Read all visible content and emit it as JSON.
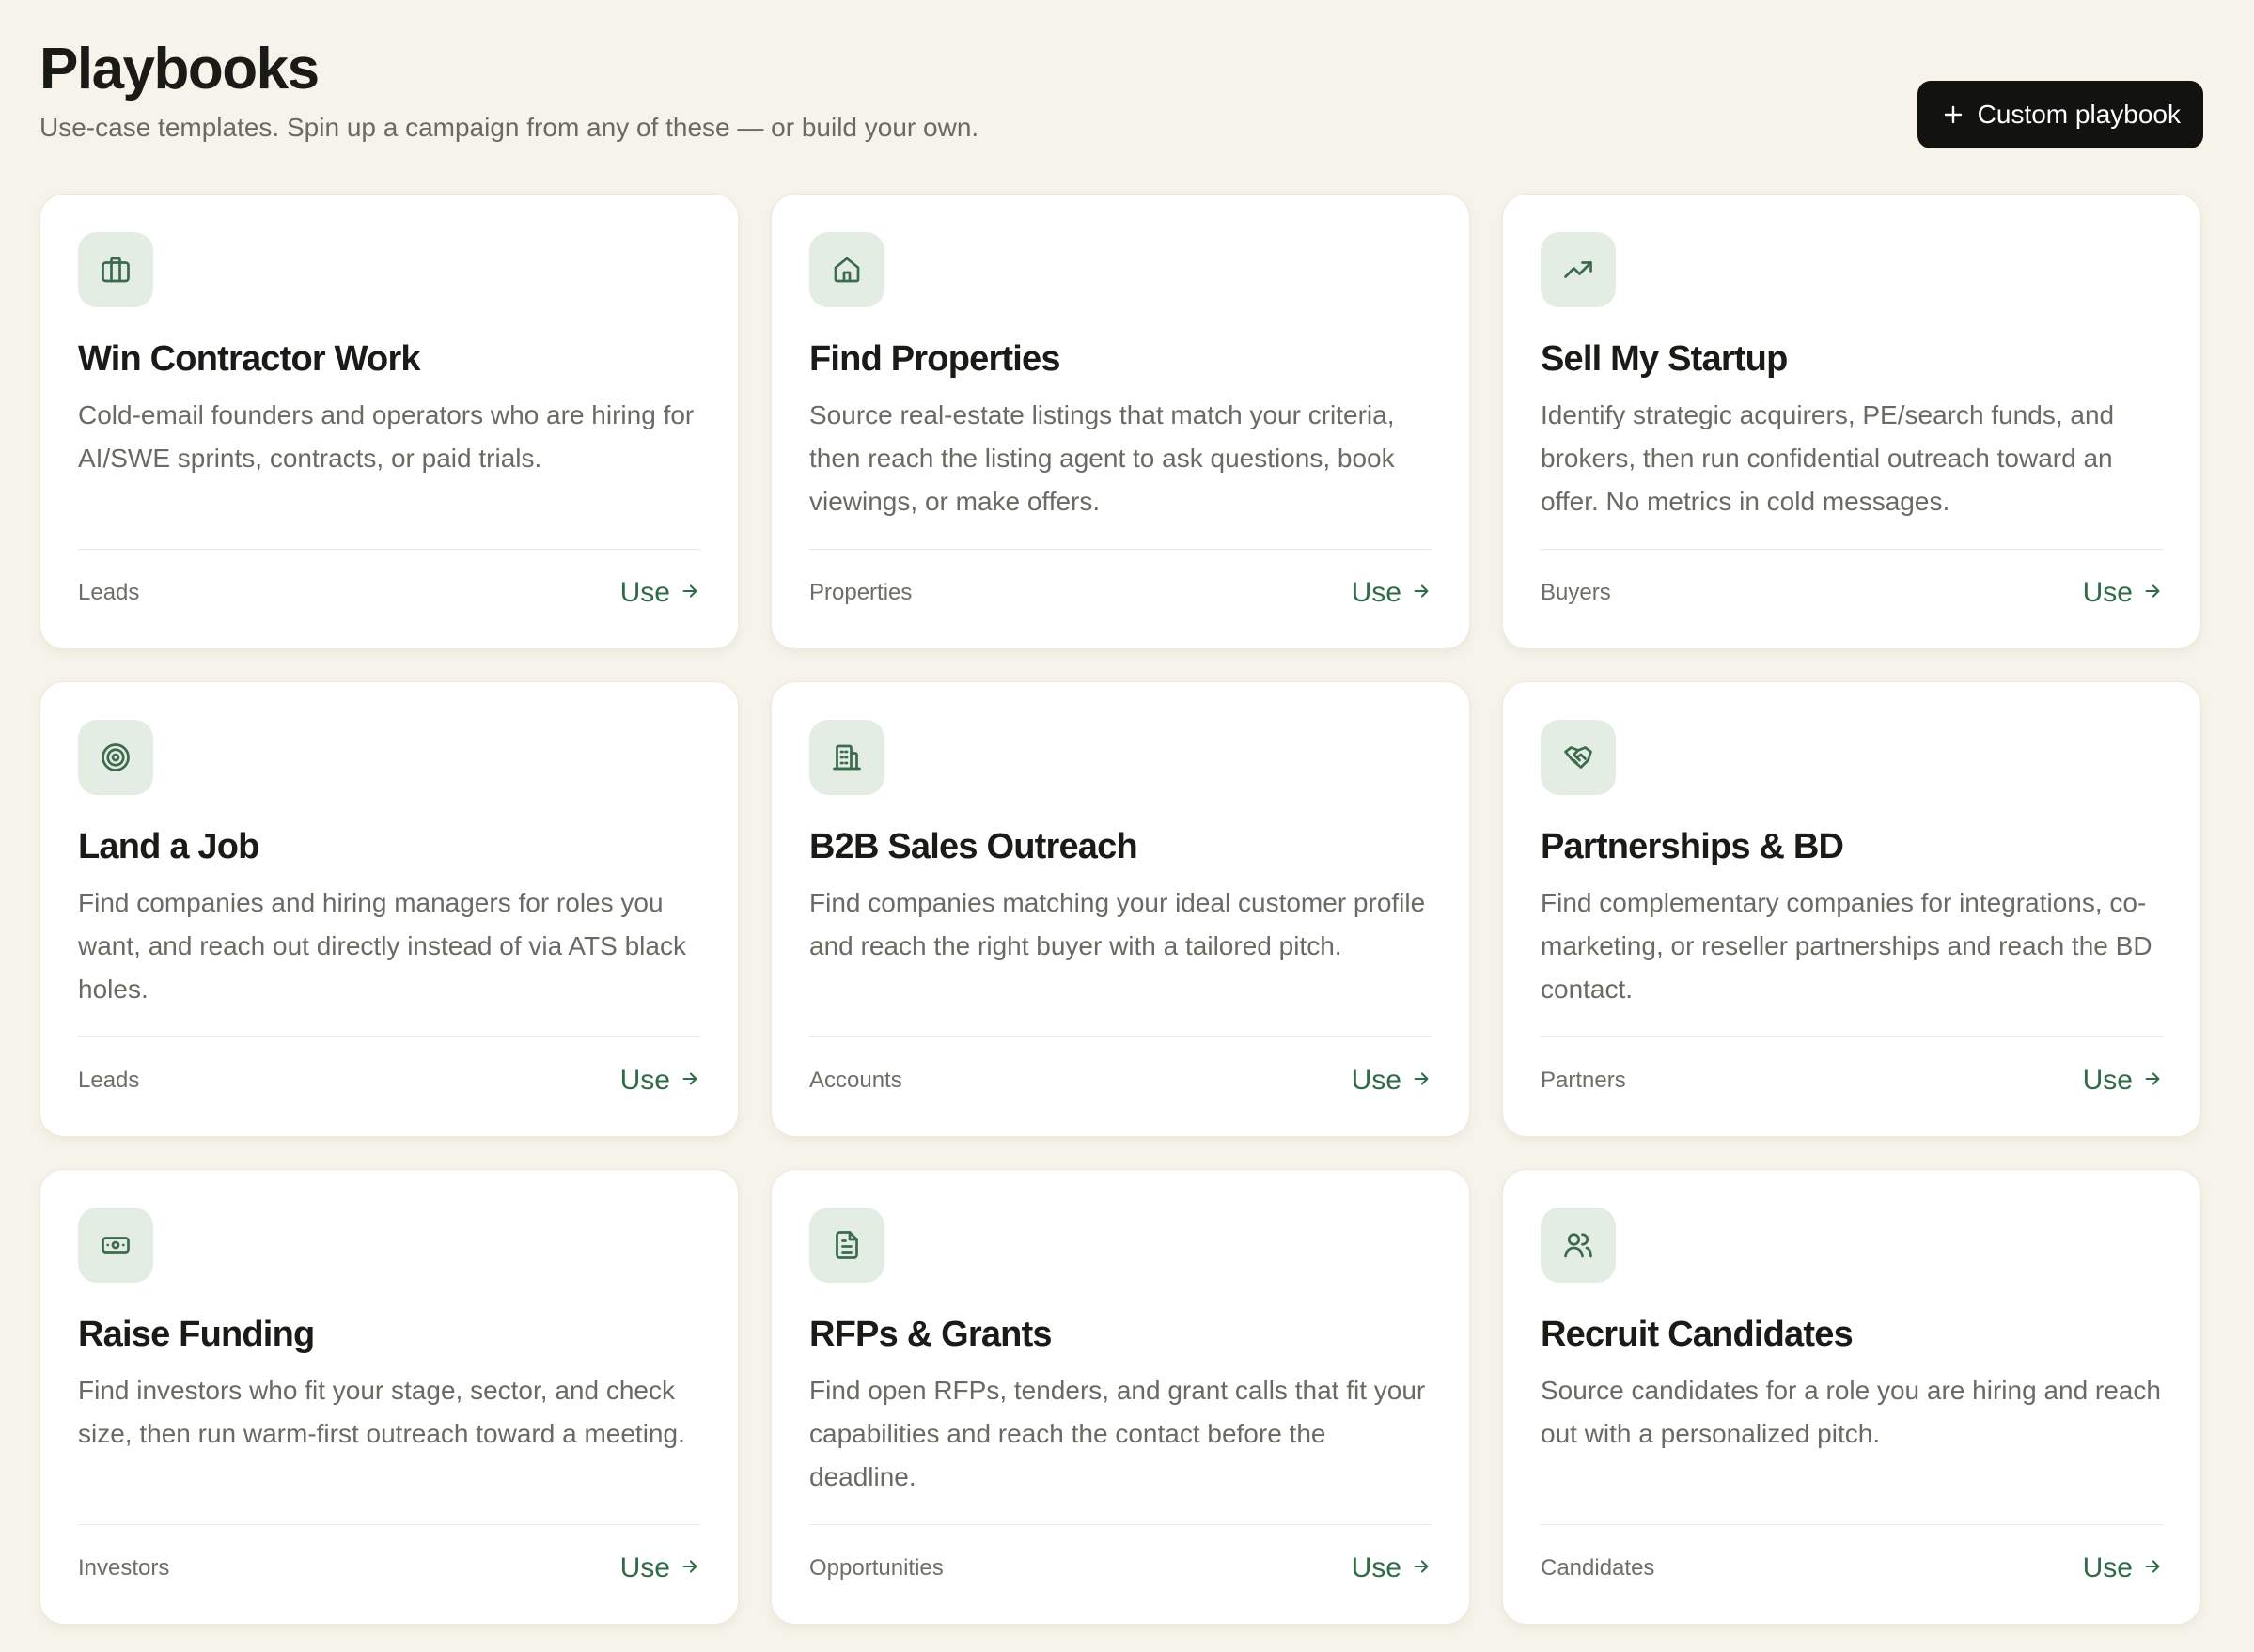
{
  "header": {
    "title": "Playbooks",
    "subtitle": "Use-case templates. Spin up a campaign from any of these — or build your own.",
    "custom_button_label": "Custom playbook"
  },
  "colors": {
    "background": "#f6f4ea",
    "card": "#ffffff",
    "icon_tile": "#e4ede4",
    "accent_green": "#2f6b47",
    "button_dark": "#121210"
  },
  "playbooks": [
    {
      "icon": "briefcase-icon",
      "title": "Win Contractor Work",
      "description": "Cold-email founders and operators who are hiring for AI/SWE sprints, contracts, or paid trials.",
      "tag": "Leads",
      "action_label": "Use"
    },
    {
      "icon": "home-icon",
      "title": "Find Properties",
      "description": "Source real-estate listings that match your criteria, then reach the listing agent to ask questions, book viewings, or make offers.",
      "tag": "Properties",
      "action_label": "Use"
    },
    {
      "icon": "trending-up-icon",
      "title": "Sell My Startup",
      "description": "Identify strategic acquirers, PE/search funds, and brokers, then run confidential outreach toward an offer. No metrics in cold messages.",
      "tag": "Buyers",
      "action_label": "Use"
    },
    {
      "icon": "target-icon",
      "title": "Land a Job",
      "description": "Find companies and hiring managers for roles you want, and reach out directly instead of via ATS black holes.",
      "tag": "Leads",
      "action_label": "Use"
    },
    {
      "icon": "building-icon",
      "title": "B2B Sales Outreach",
      "description": "Find companies matching your ideal customer profile and reach the right buyer with a tailored pitch.",
      "tag": "Accounts",
      "action_label": "Use"
    },
    {
      "icon": "handshake-icon",
      "title": "Partnerships & BD",
      "description": "Find complementary companies for integrations, co-marketing, or reseller partnerships and reach the BD contact.",
      "tag": "Partners",
      "action_label": "Use"
    },
    {
      "icon": "banknote-icon",
      "title": "Raise Funding",
      "description": "Find investors who fit your stage, sector, and check size, then run warm-first outreach toward a meeting.",
      "tag": "Investors",
      "action_label": "Use"
    },
    {
      "icon": "document-icon",
      "title": "RFPs & Grants",
      "description": "Find open RFPs, tenders, and grant calls that fit your capabilities and reach the contact before the deadline.",
      "tag": "Opportunities",
      "action_label": "Use"
    },
    {
      "icon": "users-icon",
      "title": "Recruit Candidates",
      "description": "Source candidates for a role you are hiring and reach out with a personalized pitch.",
      "tag": "Candidates",
      "action_label": "Use"
    }
  ]
}
